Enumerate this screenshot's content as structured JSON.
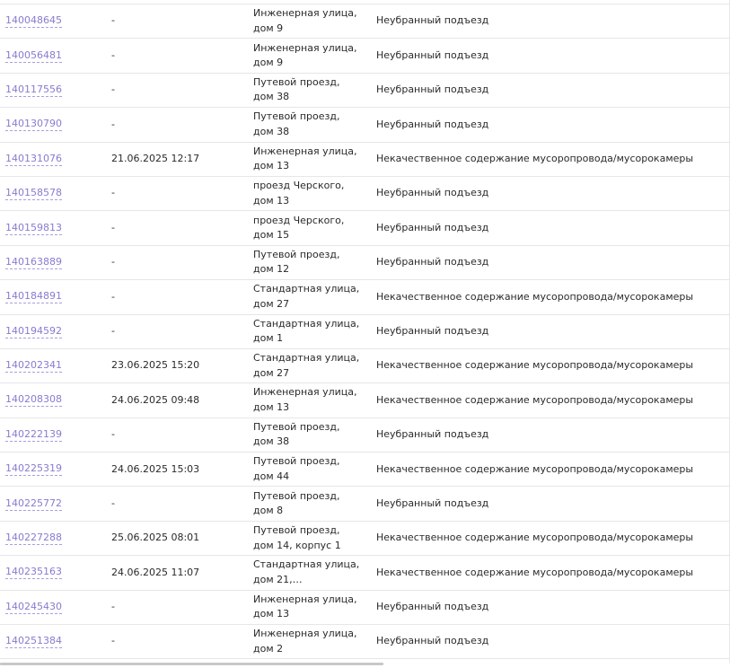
{
  "rows": [
    {
      "id": "140048645",
      "date": "-",
      "address": "Инженерная улица, дом 9",
      "type": "Неубранный подъезд"
    },
    {
      "id": "140056481",
      "date": "-",
      "address": "Инженерная улица, дом 9",
      "type": "Неубранный подъезд"
    },
    {
      "id": "140117556",
      "date": "-",
      "address": "Путевой проезд, дом 38",
      "type": "Неубранный подъезд"
    },
    {
      "id": "140130790",
      "date": "-",
      "address": "Путевой проезд, дом 38",
      "type": "Неубранный подъезд"
    },
    {
      "id": "140131076",
      "date": "21.06.2025 12:17",
      "address": "Инженерная улица, дом 13",
      "type": "Некачественное содержание мусоропровода/мусорокамеры"
    },
    {
      "id": "140158578",
      "date": "-",
      "address": "проезд Черского, дом 13",
      "type": "Неубранный подъезд"
    },
    {
      "id": "140159813",
      "date": "-",
      "address": "проезд Черского, дом 15",
      "type": "Неубранный подъезд"
    },
    {
      "id": "140163889",
      "date": "-",
      "address": "Путевой проезд, дом 12",
      "type": "Неубранный подъезд"
    },
    {
      "id": "140184891",
      "date": "-",
      "address": "Стандартная улица, дом 27",
      "type": "Некачественное содержание мусоропровода/мусорокамеры"
    },
    {
      "id": "140194592",
      "date": "-",
      "address": "Стандартная улица, дом 1",
      "type": "Неубранный подъезд"
    },
    {
      "id": "140202341",
      "date": "23.06.2025 15:20",
      "address": "Стандартная улица, дом 27",
      "type": "Некачественное содержание мусоропровода/мусорокамеры"
    },
    {
      "id": "140208308",
      "date": "24.06.2025 09:48",
      "address": "Инженерная улица, дом 13",
      "type": "Некачественное содержание мусоропровода/мусорокамеры"
    },
    {
      "id": "140222139",
      "date": "-",
      "address": "Путевой проезд, дом 38",
      "type": "Неубранный подъезд"
    },
    {
      "id": "140225319",
      "date": "24.06.2025 15:03",
      "address": "Путевой проезд, дом 44",
      "type": "Некачественное содержание мусоропровода/мусорокамеры"
    },
    {
      "id": "140225772",
      "date": "-",
      "address": "Путевой проезд, дом 8",
      "type": "Неубранный подъезд"
    },
    {
      "id": "140227288",
      "date": "25.06.2025 08:01",
      "address": "Путевой проезд, дом 14, корпус 1",
      "type": "Некачественное содержание мусоропровода/мусорокамеры"
    },
    {
      "id": "140235163",
      "date": "24.06.2025 11:07",
      "address": "Стандартная улица, дом 21,…",
      "type": "Некачественное содержание мусоропровода/мусорокамеры"
    },
    {
      "id": "140245430",
      "date": "-",
      "address": "Инженерная улица, дом 13",
      "type": "Неубранный подъезд"
    },
    {
      "id": "140251384",
      "date": "-",
      "address": "Инженерная улица, дом 2",
      "type": "Неубранный подъезд"
    }
  ]
}
